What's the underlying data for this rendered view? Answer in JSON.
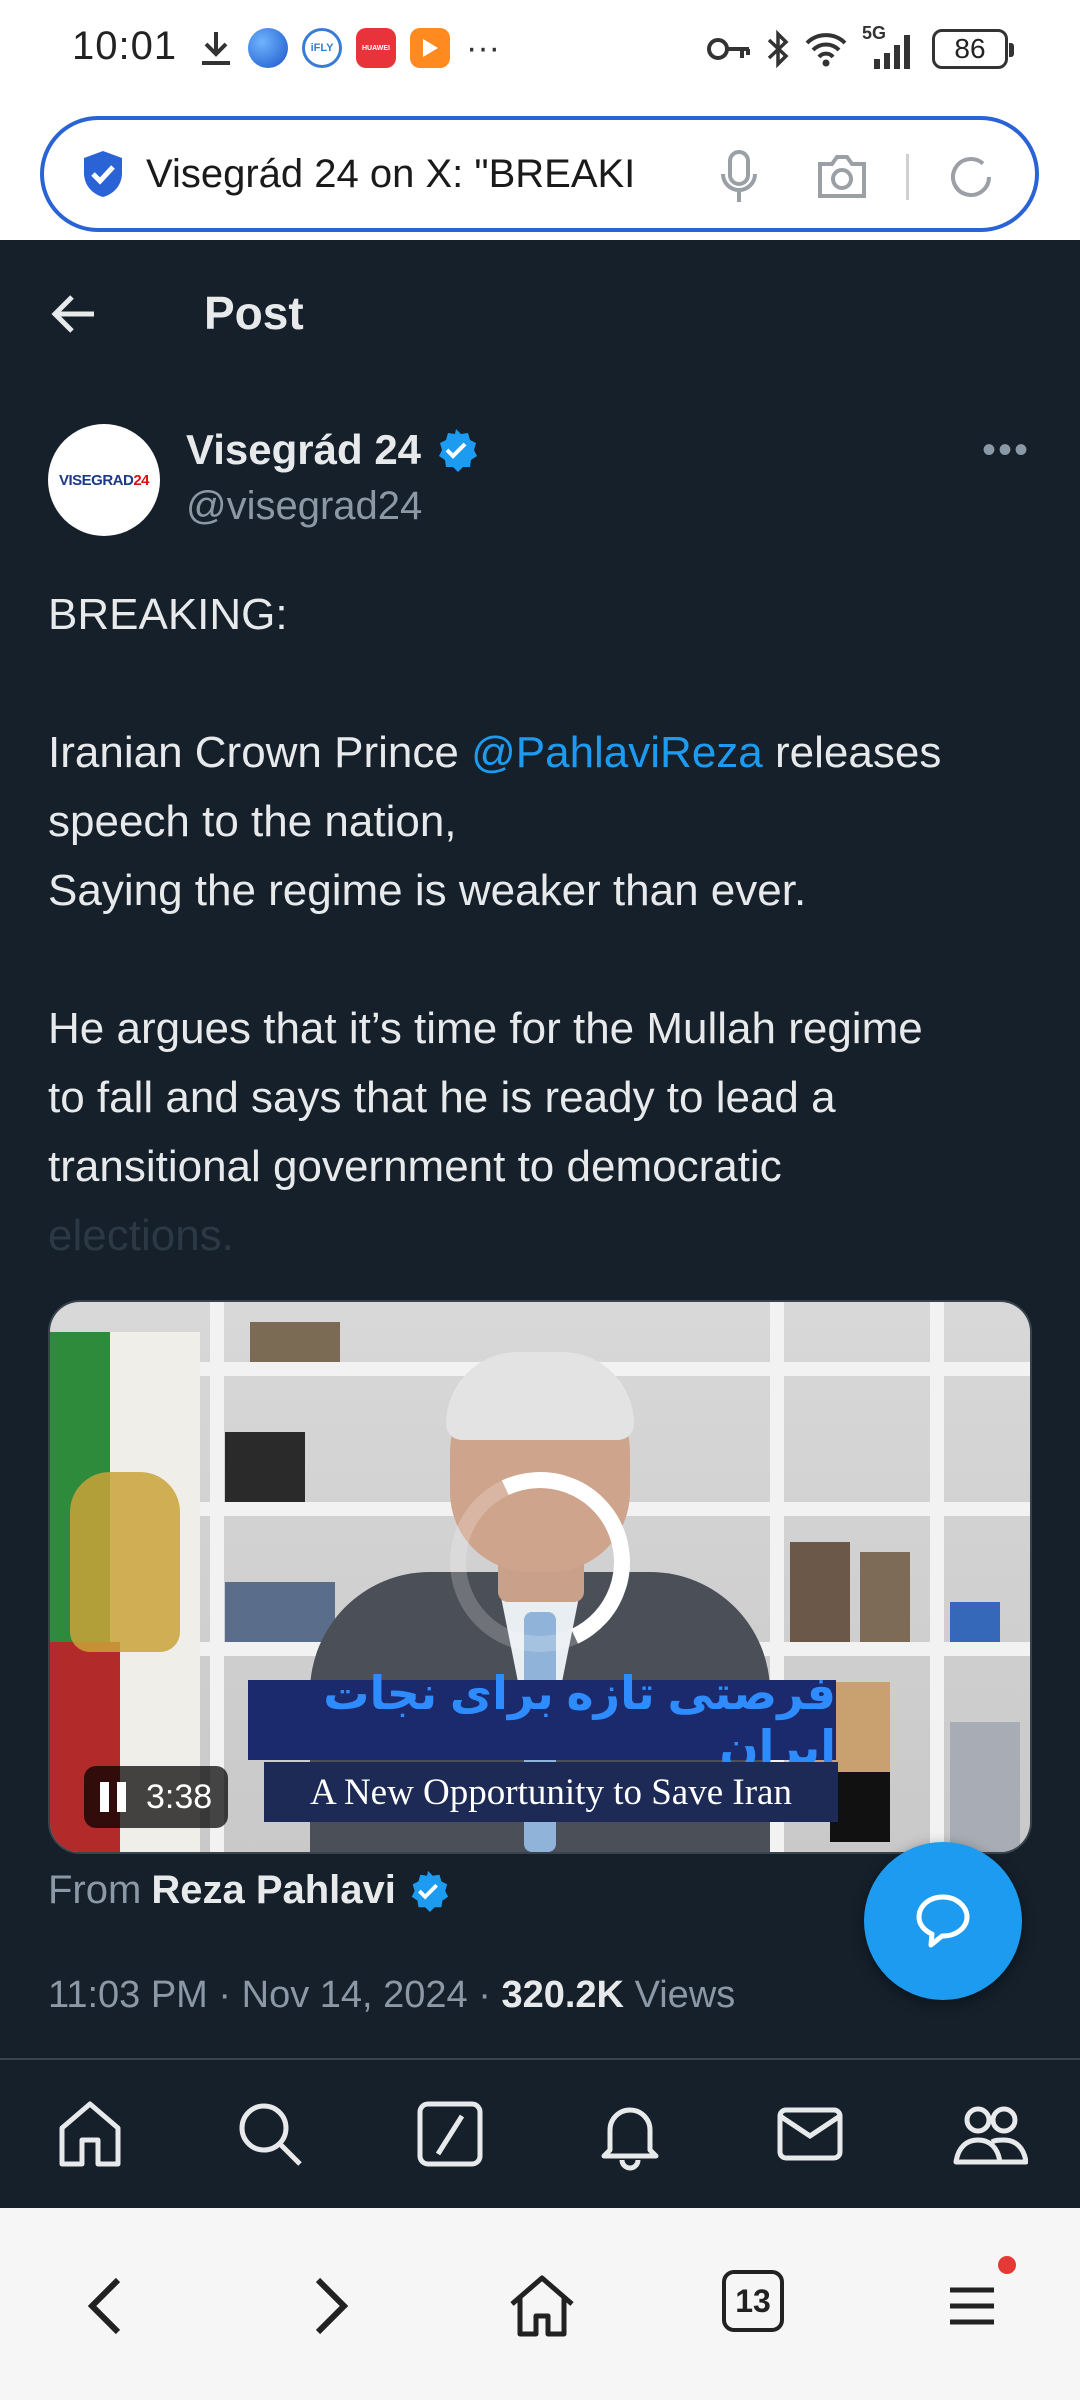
{
  "status_bar": {
    "time": "10:01",
    "network": "5G",
    "battery": "86",
    "app_icons": [
      "download-icon",
      "browser-app-icon",
      "ifly-app-icon",
      "huawei-app-icon",
      "video-app-icon"
    ],
    "ifly_label": "iFLY",
    "huawei_label": "HUAWEI",
    "more": "···"
  },
  "browser": {
    "url_text": "Visegrád 24 on X: \"BREAKI",
    "tab_count": "13",
    "accent": "#2a63d6"
  },
  "header": {
    "title": "Post"
  },
  "author": {
    "avatar_text_a": "VISEGRAD",
    "avatar_text_b": "24",
    "name": "Visegrád 24",
    "handle": "@visegrad24",
    "verified": true
  },
  "tweet": {
    "line1": "BREAKING:",
    "line2_pre": "Iranian Crown Prince ",
    "mention": "@PahlaviReza",
    "line2_post": " releases",
    "line3": "speech to the nation,",
    "line4": "Saying the regime is weaker than ever.",
    "line5": "He argues that it’s time for the Mullah regime",
    "line6": "to fall and says that he is ready to lead a",
    "line7": "transitional government to democratic",
    "line8": "elections."
  },
  "video": {
    "caption_fa": "فرصتی تازه برای نجات ایران",
    "caption_en": "A New Opportunity to Save Iran",
    "duration": "3:38",
    "from_label": "From",
    "from_name": "Reza Pahlavi"
  },
  "meta": {
    "time": "11:03 PM",
    "date": "Nov 14, 2024",
    "views_count": "320.2K",
    "views_label": "Views",
    "sep": "·"
  },
  "colors": {
    "background": "#15202b",
    "link": "#1d9bf0",
    "text": "#e7e9ea",
    "muted": "#8b98a5"
  }
}
